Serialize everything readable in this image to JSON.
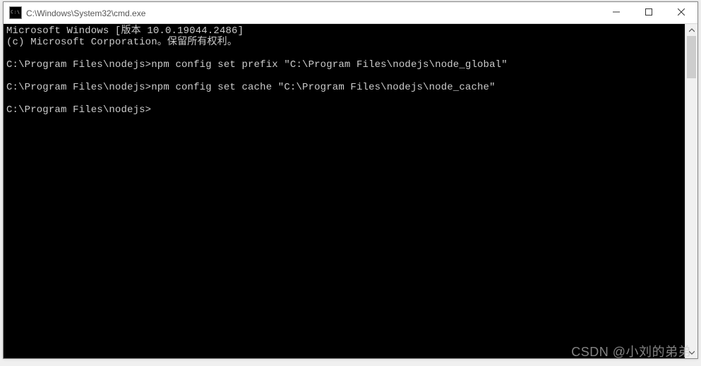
{
  "titlebar": {
    "icon_text": "C:\\",
    "title": "C:\\Windows\\System32\\cmd.exe",
    "min_name": "minimize-icon",
    "max_name": "maximize-icon",
    "close_name": "close-icon"
  },
  "terminal": {
    "lines": [
      "Microsoft Windows [版本 10.0.19044.2486]",
      "(c) Microsoft Corporation。保留所有权利。",
      "",
      "C:\\Program Files\\nodejs>npm config set prefix \"C:\\Program Files\\nodejs\\node_global\"",
      "",
      "C:\\Program Files\\nodejs>npm config set cache \"C:\\Program Files\\nodejs\\node_cache\"",
      "",
      "C:\\Program Files\\nodejs>"
    ]
  },
  "watermark": "CSDN @小刘的弟弟"
}
